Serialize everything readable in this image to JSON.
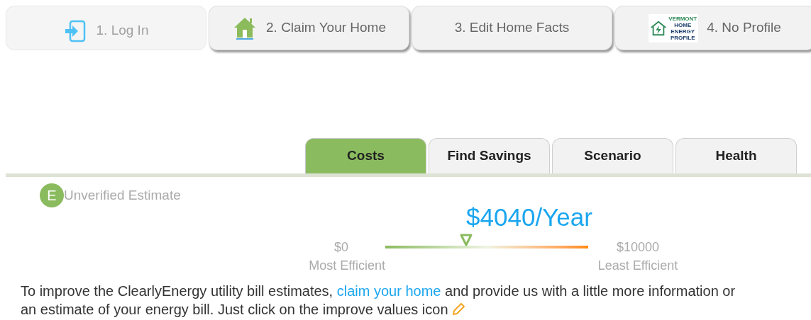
{
  "steps": [
    {
      "label": "1. Log In",
      "kind": "login",
      "disabled": true
    },
    {
      "label": "2. Claim Your Home",
      "kind": "home",
      "disabled": false
    },
    {
      "label": "3. Edit Home Facts",
      "kind": "plain",
      "disabled": false
    },
    {
      "label": "4. No Profile",
      "kind": "profile",
      "disabled": false,
      "logo_text": [
        "VERMONT",
        "HOME",
        "ENERGY",
        "PROFILE"
      ]
    }
  ],
  "tabs": [
    {
      "label": "Costs",
      "selected": true
    },
    {
      "label": "Find Savings",
      "selected": false
    },
    {
      "label": "Scenario",
      "selected": false
    },
    {
      "label": "Health",
      "selected": false
    }
  ],
  "badge": {
    "letter": "E",
    "label": "Unverified Estimate"
  },
  "cost": {
    "value": "$4040/Year",
    "level": 0.4,
    "min_value": "$0",
    "min_label": "Most Efficient",
    "max_value": "$10000",
    "max_label": "Least Efficient"
  },
  "message": {
    "before": "To improve the ClearlyEnergy utility bill estimates, ",
    "link": "claim your home",
    "after": " and provide us with a little more information or an estimate of your energy bill. Just click on the improve values icon"
  }
}
